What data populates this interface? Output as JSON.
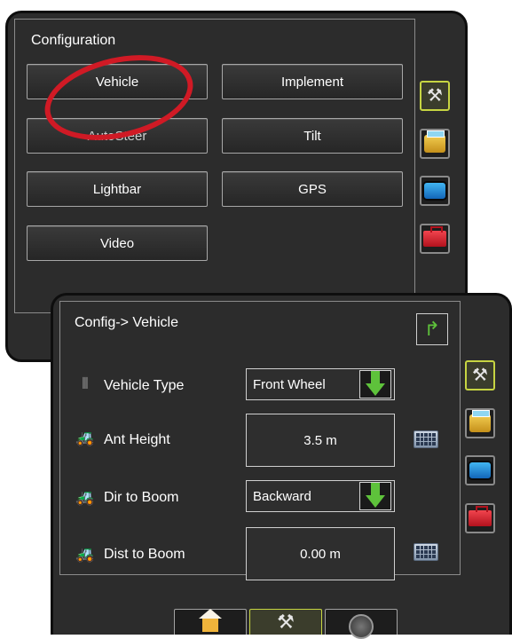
{
  "config_panel": {
    "title": "Configuration",
    "buttons": [
      {
        "label": "Vehicle"
      },
      {
        "label": "Implement"
      },
      {
        "label": "AutoSteer"
      },
      {
        "label": "Tilt"
      },
      {
        "label": "Lightbar"
      },
      {
        "label": "GPS"
      },
      {
        "label": "Video"
      }
    ]
  },
  "vehicle_panel": {
    "title": "Config-> Vehicle",
    "rows": [
      {
        "label": "Vehicle Type",
        "value": "Front Wheel",
        "control": "dropdown",
        "icon": "wheel-icon"
      },
      {
        "label": "Ant Height",
        "value": "3.5 m",
        "control": "keypad",
        "icon": "tractor-icon"
      },
      {
        "label": "Dir to Boom",
        "value": "Backward",
        "control": "dropdown",
        "icon": "tractor-direction-icon"
      },
      {
        "label": "Dist to Boom",
        "value": "0.00 m",
        "control": "keypad",
        "icon": "tractor-distance-icon"
      }
    ]
  },
  "side_tabs": [
    {
      "icon": "tools-icon",
      "active": true
    },
    {
      "icon": "folder-icon",
      "active": false
    },
    {
      "icon": "display-icon",
      "active": false
    },
    {
      "icon": "toolbox-icon",
      "active": false
    }
  ],
  "bottom_nav": [
    {
      "icon": "home-icon",
      "active": false
    },
    {
      "icon": "tools-icon",
      "active": true
    },
    {
      "icon": "gauge-icon",
      "active": false
    }
  ],
  "colors": {
    "panel_bg": "#2c2c2c",
    "active_tab_border": "#c7d542",
    "highlight_circle": "#d01a25",
    "arrow_green": "#5ec23b"
  }
}
